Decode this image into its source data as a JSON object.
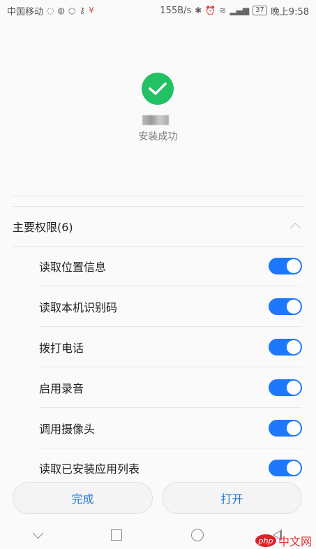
{
  "status_bar": {
    "carrier": "中国移动",
    "speed": "155B/s",
    "battery": "37",
    "time": "晚上9:58"
  },
  "install": {
    "status_text": "安装成功"
  },
  "permissions": {
    "title": "主要权限(6)",
    "items": [
      {
        "label": "读取位置信息",
        "enabled": true
      },
      {
        "label": "读取本机识别码",
        "enabled": true
      },
      {
        "label": "拨打电话",
        "enabled": true
      },
      {
        "label": "启用录音",
        "enabled": true
      },
      {
        "label": "调用摄像头",
        "enabled": true
      },
      {
        "label": "读取已安装应用列表",
        "enabled": true
      }
    ]
  },
  "actions": {
    "done_label": "完成",
    "open_label": "打开"
  },
  "watermark": {
    "logo_text": "php",
    "site_text": "中文网"
  },
  "colors": {
    "success": "#21c164",
    "accent": "#1e78ff",
    "action_text": "#1f78d9"
  }
}
